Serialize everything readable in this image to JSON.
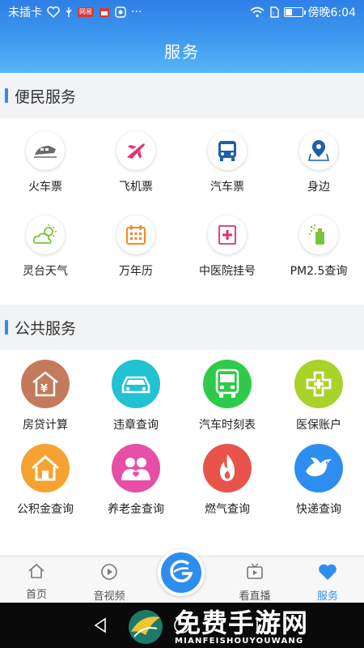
{
  "status_bar": {
    "carrier": "未插卡",
    "badge1": "网易",
    "more": "···",
    "time": "傍晚6:04"
  },
  "header": {
    "title": "服务"
  },
  "sections": [
    {
      "title": "便民服务",
      "items": [
        {
          "label": "火车票",
          "icon": "train-icon"
        },
        {
          "label": "飞机票",
          "icon": "airplane-icon"
        },
        {
          "label": "汽车票",
          "icon": "bus-icon"
        },
        {
          "label": "身边",
          "icon": "map-pin-icon"
        },
        {
          "label": "灵台天气",
          "icon": "weather-icon"
        },
        {
          "label": "万年历",
          "icon": "calendar-icon"
        },
        {
          "label": "中医院挂号",
          "icon": "hospital-icon"
        },
        {
          "label": "PM2.5查询",
          "icon": "air-quality-icon"
        }
      ]
    },
    {
      "title": "公共服务",
      "items": [
        {
          "label": "房贷计算",
          "icon": "house-loan-icon",
          "color": "#c47b5c"
        },
        {
          "label": "违章查询",
          "icon": "car-icon",
          "color": "#21c2d2"
        },
        {
          "label": "汽车时刻表",
          "icon": "bus-schedule-icon",
          "color": "#2ecb4a"
        },
        {
          "label": "医保账户",
          "icon": "medical-cross-icon",
          "color": "#a9d22a"
        },
        {
          "label": "公积金查询",
          "icon": "home-fund-icon",
          "color": "#f5a231"
        },
        {
          "label": "养老金查询",
          "icon": "pension-icon",
          "color": "#e74ea5"
        },
        {
          "label": "燃气查询",
          "icon": "flame-icon",
          "color": "#e8544a"
        },
        {
          "label": "快递查询",
          "icon": "dove-icon",
          "color": "#2d8ef0"
        }
      ]
    }
  ],
  "bottom_nav": {
    "items": [
      {
        "label": "首页",
        "icon": "home-icon"
      },
      {
        "label": "音视频",
        "icon": "play-icon"
      },
      {
        "label": "看直播",
        "icon": "tv-icon"
      },
      {
        "label": "服务",
        "icon": "heart-icon",
        "active": true
      }
    ]
  },
  "watermark": {
    "title": "免费手游网",
    "subtitle": "MIANFEISHOUYOUWANG"
  },
  "colors": {
    "accent": "#2d8ef0",
    "header_top": "#2f7fe6",
    "header_bottom": "#57b5f6"
  }
}
